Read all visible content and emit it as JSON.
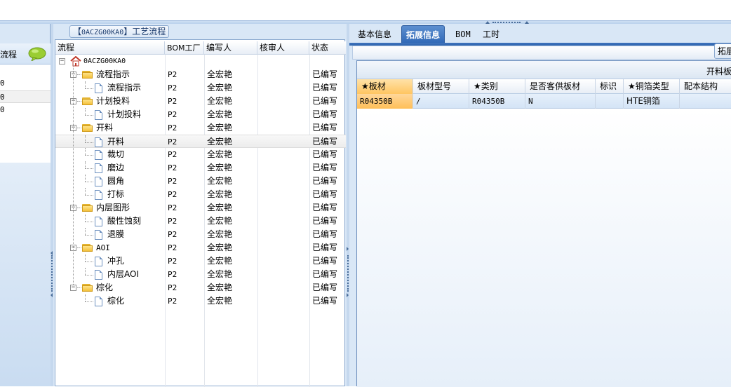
{
  "left_panel": {
    "header_label": "流程",
    "list_items": [
      "0",
      "0",
      "0"
    ]
  },
  "middle_panel": {
    "title_prefix": "【",
    "title_code": "0ACZG00KA0",
    "title_suffix": "】工艺流程",
    "columns": [
      "流程",
      "BOM工厂",
      "编写人",
      "核审人",
      "状态"
    ],
    "root": {
      "label": "0ACZG00KA0"
    },
    "rows": [
      {
        "label": "流程指示",
        "level": 1,
        "type": "folder",
        "bom": "P2",
        "author": "全宏艳",
        "reviewer": "",
        "status": "已编写"
      },
      {
        "label": "流程指示",
        "level": 2,
        "type": "doc",
        "bom": "P2",
        "author": "全宏艳",
        "reviewer": "",
        "status": "已编写"
      },
      {
        "label": "计划投料",
        "level": 1,
        "type": "folder",
        "bom": "P2",
        "author": "全宏艳",
        "reviewer": "",
        "status": "已编写"
      },
      {
        "label": "计划投料",
        "level": 2,
        "type": "doc",
        "bom": "P2",
        "author": "全宏艳",
        "reviewer": "",
        "status": "已编写"
      },
      {
        "label": "开料",
        "level": 1,
        "type": "folder",
        "bom": "P2",
        "author": "全宏艳",
        "reviewer": "",
        "status": "已编写"
      },
      {
        "label": "开料",
        "level": 2,
        "type": "doc",
        "bom": "P2",
        "author": "全宏艳",
        "reviewer": "",
        "status": "已编写",
        "selected": true
      },
      {
        "label": "裁切",
        "level": 2,
        "type": "doc",
        "bom": "P2",
        "author": "全宏艳",
        "reviewer": "",
        "status": "已编写"
      },
      {
        "label": "磨边",
        "level": 2,
        "type": "doc",
        "bom": "P2",
        "author": "全宏艳",
        "reviewer": "",
        "status": "已编写"
      },
      {
        "label": "圆角",
        "level": 2,
        "type": "doc",
        "bom": "P2",
        "author": "全宏艳",
        "reviewer": "",
        "status": "已编写"
      },
      {
        "label": "打标",
        "level": 2,
        "type": "doc",
        "bom": "P2",
        "author": "全宏艳",
        "reviewer": "",
        "status": "已编写"
      },
      {
        "label": "内层图形",
        "level": 1,
        "type": "folder",
        "bom": "P2",
        "author": "全宏艳",
        "reviewer": "",
        "status": "已编写"
      },
      {
        "label": "酸性蚀刻",
        "level": 2,
        "type": "doc",
        "bom": "P2",
        "author": "全宏艳",
        "reviewer": "",
        "status": "已编写"
      },
      {
        "label": "退膜",
        "level": 2,
        "type": "doc",
        "bom": "P2",
        "author": "全宏艳",
        "reviewer": "",
        "status": "已编写"
      },
      {
        "label": "AOI",
        "level": 1,
        "type": "folder",
        "bom": "P2",
        "author": "全宏艳",
        "reviewer": "",
        "status": "已编写"
      },
      {
        "label": "冲孔",
        "level": 2,
        "type": "doc",
        "bom": "P2",
        "author": "全宏艳",
        "reviewer": "",
        "status": "已编写"
      },
      {
        "label": "内层AOI",
        "level": 2,
        "type": "doc",
        "bom": "P2",
        "author": "全宏艳",
        "reviewer": "",
        "status": "已编写"
      },
      {
        "label": "棕化",
        "level": 1,
        "type": "folder",
        "bom": "P2",
        "author": "全宏艳",
        "reviewer": "",
        "status": "已编写"
      },
      {
        "label": "棕化",
        "level": 2,
        "type": "doc",
        "bom": "P2",
        "author": "全宏艳",
        "reviewer": "",
        "status": "已编写"
      }
    ]
  },
  "right_panel": {
    "tabs": [
      {
        "label": "基本信息",
        "active": false
      },
      {
        "label": "拓展信息",
        "active": true
      },
      {
        "label": "BOM",
        "active": false
      },
      {
        "label": "工时",
        "active": false
      }
    ],
    "expand_button": "拓展",
    "grid_group_title": "开料板",
    "grid_columns": [
      "★板材",
      "板材型号",
      "★类别",
      "是否客供板材",
      "标识",
      "★铜箔类型",
      "配本结构"
    ],
    "grid_rows": [
      [
        "R04350B",
        "/",
        "R04350B",
        "N",
        "",
        "HTE铜箔",
        ""
      ]
    ]
  },
  "colors": {
    "panel_bg": "#d9e7f6",
    "active_tab": "#2f68b6",
    "key_column": "#ffc561",
    "selected_row": "#d4e4f6"
  }
}
